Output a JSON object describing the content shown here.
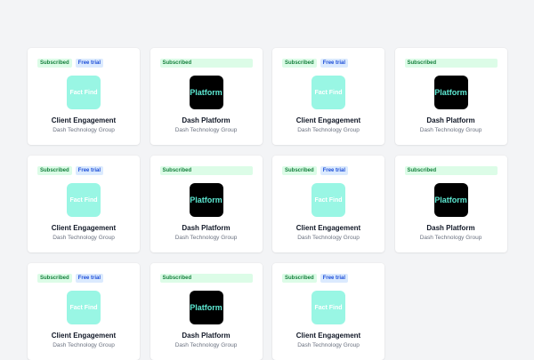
{
  "colors": {
    "page_bg": "#f3f4f6",
    "card_bg": "#ffffff",
    "subscribed_bg": "#dcfce7",
    "subscribed_text": "#15803d",
    "free_trial_bg": "#dbeafe",
    "free_trial_text": "#1d4ed8",
    "fact_find_logo_bg": "#99f6e4",
    "platform_logo_bg": "#000000",
    "platform_logo_text": "#5eead4"
  },
  "products": [
    {
      "name": "Client Engagement",
      "company": "Dash Technology Group",
      "logo_text": "Fact Find",
      "logo_style": "ff",
      "badges": {
        "subscribed": "Subscribed",
        "free_trial": "Free trial"
      }
    },
    {
      "name": "Dash Platform",
      "company": "Dash Technology Group",
      "logo_text": "Platform",
      "logo_style": "dp",
      "badges": {
        "subscribed": "Subscribed"
      }
    },
    {
      "name": "Client Engagement",
      "company": "Dash Technology Group",
      "logo_text": "Fact Find",
      "logo_style": "ff",
      "badges": {
        "subscribed": "Subscribed",
        "free_trial": "Free trial"
      }
    },
    {
      "name": "Dash Platform",
      "company": "Dash Technology Group",
      "logo_text": "Platform",
      "logo_style": "dp",
      "badges": {
        "subscribed": "Subscribed"
      }
    },
    {
      "name": "Client Engagement",
      "company": "Dash Technology Group",
      "logo_text": "Fact Find",
      "logo_style": "ff",
      "badges": {
        "subscribed": "Subscribed",
        "free_trial": "Free trial"
      }
    },
    {
      "name": "Dash Platform",
      "company": "Dash Technology Group",
      "logo_text": "Platform",
      "logo_style": "dp",
      "badges": {
        "subscribed": "Subscribed"
      }
    },
    {
      "name": "Client Engagement",
      "company": "Dash Technology Group",
      "logo_text": "Fact Find",
      "logo_style": "ff",
      "badges": {
        "subscribed": "Subscribed",
        "free_trial": "Free trial"
      }
    },
    {
      "name": "Dash Platform",
      "company": "Dash Technology Group",
      "logo_text": "Platform",
      "logo_style": "dp",
      "badges": {
        "subscribed": "Subscribed"
      }
    },
    {
      "name": "Client Engagement",
      "company": "Dash Technology Group",
      "logo_text": "Fact Find",
      "logo_style": "ff",
      "badges": {
        "subscribed": "Subscribed",
        "free_trial": "Free trial"
      }
    },
    {
      "name": "Dash Platform",
      "company": "Dash Technology Group",
      "logo_text": "Platform",
      "logo_style": "dp",
      "badges": {
        "subscribed": "Subscribed"
      }
    },
    {
      "name": "Client Engagement",
      "company": "Dash Technology Group",
      "logo_text": "Fact Find",
      "logo_style": "ff",
      "badges": {
        "subscribed": "Subscribed",
        "free_trial": "Free trial"
      }
    }
  ]
}
